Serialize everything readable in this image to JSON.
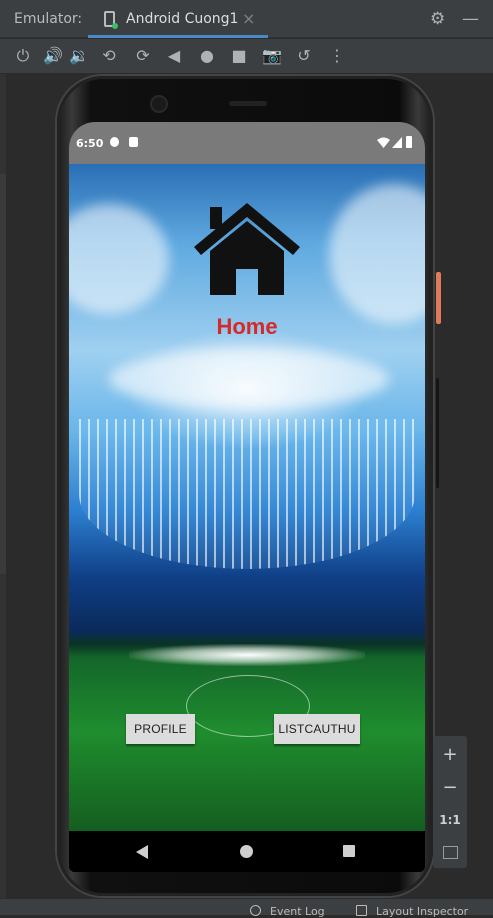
{
  "window": {
    "title": "Emulator:",
    "tab_title": "Android Cuong1",
    "tab_close": "×"
  },
  "title_icons": {
    "settings": "gear-icon",
    "minimize": "minimize-icon"
  },
  "toolbar": {
    "icons": [
      "power-icon",
      "volume-up-icon",
      "volume-down-icon",
      "rotate-left-icon",
      "rotate-right-icon",
      "back-icon",
      "home-icon",
      "overview-icon",
      "camera-icon",
      "snapshot-icon",
      "more-icon"
    ]
  },
  "status_bar": {
    "time": "6:50"
  },
  "app": {
    "title": "Home",
    "title_color": "#d62a2a",
    "buttons": {
      "profile": "PROFILE",
      "list": "LISTCAUTHU"
    }
  },
  "zoom": {
    "zoom_in": "+",
    "zoom_out": "−",
    "actual_size": "1:1"
  },
  "bottom_bar": {
    "event_log": "Event Log",
    "layout_inspector": "Layout Inspector"
  }
}
